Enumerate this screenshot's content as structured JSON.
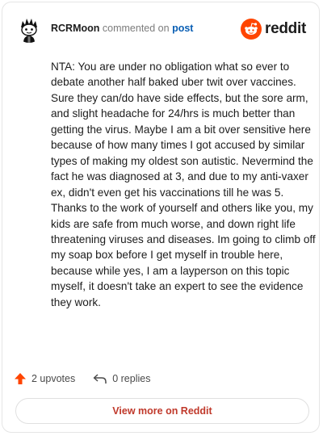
{
  "header": {
    "username": "RCRMoon",
    "action": "commented on",
    "target": "post",
    "logo_text": "reddit"
  },
  "comment": {
    "text": "NTA: You are under no obligation what so ever to debate another half baked uber twit over vaccines. Sure they can/do have side effects, but the sore arm, and slight headache for 24/hrs is much better than getting the virus. Maybe I am a bit over sensitive here because of how many times I got accused by similar types of making my oldest son autistic. Nevermind the fact he was diagnosed at 3, and due to my anti-vaxer ex, didn't even get his vaccinations till he was 5. Thanks to the work of yourself and others like you, my kids are safe from much worse, and down right life threatening viruses and diseases. Im going to climb off my soap box before I get myself in trouble here, because while yes, I am a layperson on this topic myself, it doesn't take an expert to see the evidence they work."
  },
  "stats": {
    "upvotes": "2 upvotes",
    "replies": "0 replies"
  },
  "footer": {
    "more_label": "View more on Reddit"
  },
  "colors": {
    "accent": "#ff4500",
    "link": "#0a5fb4",
    "button_text": "#c0392b"
  },
  "icons": {
    "avatar": "snoo-avatar",
    "logo": "reddit-logo-icon",
    "upvote": "upvote-arrow-icon",
    "reply": "reply-arrow-icon"
  }
}
